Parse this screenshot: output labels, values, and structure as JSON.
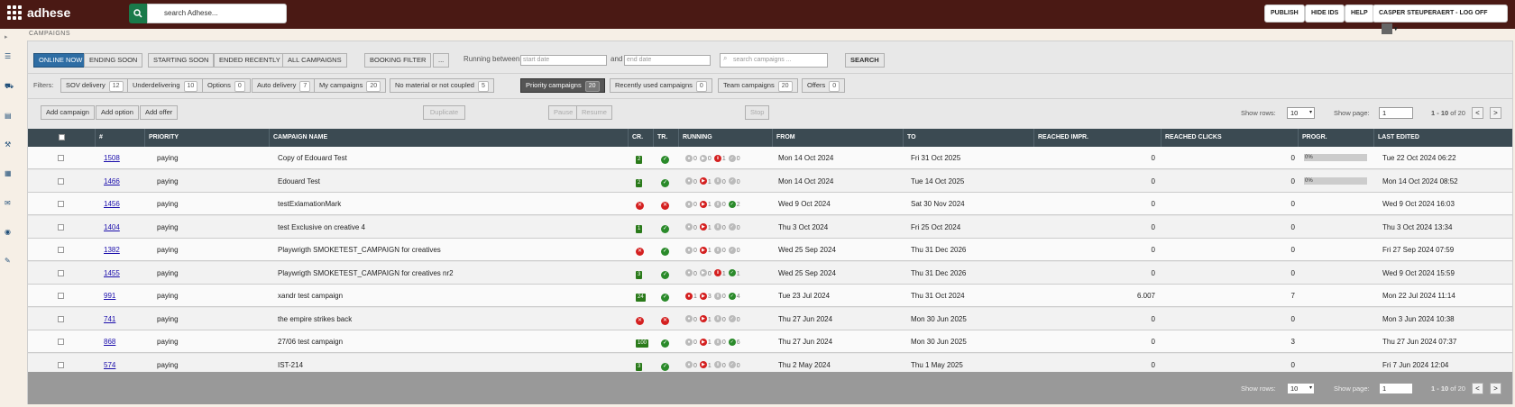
{
  "app": {
    "name": "adhese"
  },
  "search": {
    "placeholder": "search Adhese..."
  },
  "topbar": {
    "publish": "PUBLISH",
    "hide_ids": "HIDE IDS",
    "help": "HELP",
    "user": "CASPER STEUPERAERT - LOG OFF"
  },
  "breadcrumb": "CAMPAIGNS",
  "tabs": [
    "ONLINE NOW",
    "ENDING SOON",
    "STARTING SOON",
    "ENDED RECENTLY",
    "ALL CAMPAIGNS"
  ],
  "booking_filter": "BOOKING FILTER",
  "more": "...",
  "running_between": "Running between",
  "start_placeholder": "start date",
  "and_label": "and",
  "end_placeholder": "end date",
  "campaign_search_placeholder": "search campaigns ...",
  "search_button": "SEARCH",
  "filters_label": "Filters:",
  "filters": [
    {
      "label": "SOV delivery",
      "count": "12"
    },
    {
      "label": "Underdelivering",
      "count": "10"
    },
    {
      "label": "Options",
      "count": "0"
    },
    {
      "label": "Auto delivery",
      "count": "7"
    },
    {
      "label": "My campaigns",
      "count": "20"
    },
    {
      "label": "No material or not coupled",
      "count": "5"
    },
    {
      "label": "Priority campaigns",
      "count": "20"
    },
    {
      "label": "Recently used campaigns",
      "count": "0"
    },
    {
      "label": "Team campaigns",
      "count": "20"
    },
    {
      "label": "Offers",
      "count": "0"
    }
  ],
  "actions": {
    "add_campaign": "Add campaign",
    "add_option": "Add option",
    "add_offer": "Add offer",
    "duplicate": "Duplicate",
    "pause": "Pause",
    "resume": "Resume",
    "stop": "Stop"
  },
  "pager": {
    "show_rows": "Show rows:",
    "rows": "10",
    "show_page": "Show page:",
    "page": "1",
    "range": "1 - 10",
    "of": "of 20",
    "prev": "<",
    "next": ">"
  },
  "columns": [
    "#",
    "PRIORITY",
    "CAMPAIGN NAME",
    "CR.",
    "TR.",
    "RUNNING",
    "FROM",
    "TO",
    "REACHED IMPR.",
    "REACHED CLICKS",
    "PROGR.",
    "LAST EDITED"
  ],
  "rows": [
    {
      "id": "1508",
      "priority": "paying",
      "name": "Copy of Edouard Test",
      "cr": "2",
      "tr": "ok",
      "run": [
        "0",
        "0",
        "1",
        "0"
      ],
      "from": "Mon 14 Oct 2024",
      "to": "Fri 31 Oct 2025",
      "impr": "0",
      "clicks": "0",
      "prog": "0%",
      "edited": "Tue 22 Oct 2024 06:22"
    },
    {
      "id": "1466",
      "priority": "paying",
      "name": "Edouard Test",
      "cr": "2",
      "tr": "ok",
      "run": [
        "0",
        "1",
        "0",
        "0"
      ],
      "from": "Mon 14 Oct 2024",
      "to": "Tue 14 Oct 2025",
      "impr": "0",
      "clicks": "0",
      "prog": "0%",
      "edited": "Mon 14 Oct 2024 08:52"
    },
    {
      "id": "1456",
      "priority": "paying",
      "name": "testExlamationMark",
      "cr": "x",
      "tr": "x",
      "run": [
        "0",
        "1",
        "0",
        "2"
      ],
      "from": "Wed 9 Oct 2024",
      "to": "Sat 30 Nov 2024",
      "impr": "0",
      "clicks": "0",
      "prog": "",
      "edited": "Wed 9 Oct 2024 16:03"
    },
    {
      "id": "1404",
      "priority": "paying",
      "name": "test Exclusive on creative 4",
      "cr": "1",
      "tr": "ok",
      "run": [
        "0",
        "1",
        "0",
        "0"
      ],
      "from": "Thu 3 Oct 2024",
      "to": "Fri 25 Oct 2024",
      "impr": "0",
      "clicks": "0",
      "prog": "",
      "edited": "Thu 3 Oct 2024 13:34"
    },
    {
      "id": "1382",
      "priority": "paying",
      "name": "Playwrigth SMOKETEST_CAMPAIGN for creatives",
      "cr": "x",
      "tr": "ok",
      "run": [
        "0",
        "1",
        "0",
        "0"
      ],
      "from": "Wed 25 Sep 2024",
      "to": "Thu 31 Dec 2026",
      "impr": "0",
      "clicks": "0",
      "prog": "",
      "edited": "Fri 27 Sep 2024 07:59"
    },
    {
      "id": "1455",
      "priority": "paying",
      "name": "Playwrigth SMOKETEST_CAMPAIGN for creatives nr2",
      "cr": "3",
      "tr": "ok",
      "run": [
        "0",
        "0",
        "1",
        "1"
      ],
      "from": "Wed 25 Sep 2024",
      "to": "Thu 31 Dec 2026",
      "impr": "0",
      "clicks": "0",
      "prog": "",
      "edited": "Wed 9 Oct 2024 15:59"
    },
    {
      "id": "991",
      "priority": "paying",
      "name": "xandr test campaign",
      "cr": "24",
      "tr": "ok",
      "run": [
        "1",
        "3",
        "0",
        "4"
      ],
      "from": "Tue 23 Jul 2024",
      "to": "Thu 31 Oct 2024",
      "impr": "6.007",
      "clicks": "7",
      "prog": "",
      "edited": "Mon 22 Jul 2024 11:14"
    },
    {
      "id": "741",
      "priority": "paying",
      "name": "the empire strikes back",
      "cr": "x",
      "tr": "x",
      "run": [
        "0",
        "1",
        "0",
        "0"
      ],
      "from": "Thu 27 Jun 2024",
      "to": "Mon 30 Jun 2025",
      "impr": "0",
      "clicks": "0",
      "prog": "",
      "edited": "Mon 3 Jun 2024 10:38"
    },
    {
      "id": "868",
      "priority": "paying",
      "name": "27/06 test campaign",
      "cr": "100",
      "tr": "ok",
      "run": [
        "0",
        "1",
        "0",
        "6"
      ],
      "from": "Thu 27 Jun 2024",
      "to": "Mon 30 Jun 2025",
      "impr": "0",
      "clicks": "3",
      "prog": "",
      "edited": "Thu 27 Jun 2024 07:37"
    },
    {
      "id": "574",
      "priority": "paying",
      "name": "IST-214",
      "cr": "3",
      "tr": "ok",
      "run": [
        "0",
        "1",
        "0",
        "0"
      ],
      "from": "Thu 2 May 2024",
      "to": "Thu 1 May 2025",
      "impr": "0",
      "clicks": "0",
      "prog": "",
      "edited": "Fri 7 Jun 2024 12:04"
    }
  ]
}
